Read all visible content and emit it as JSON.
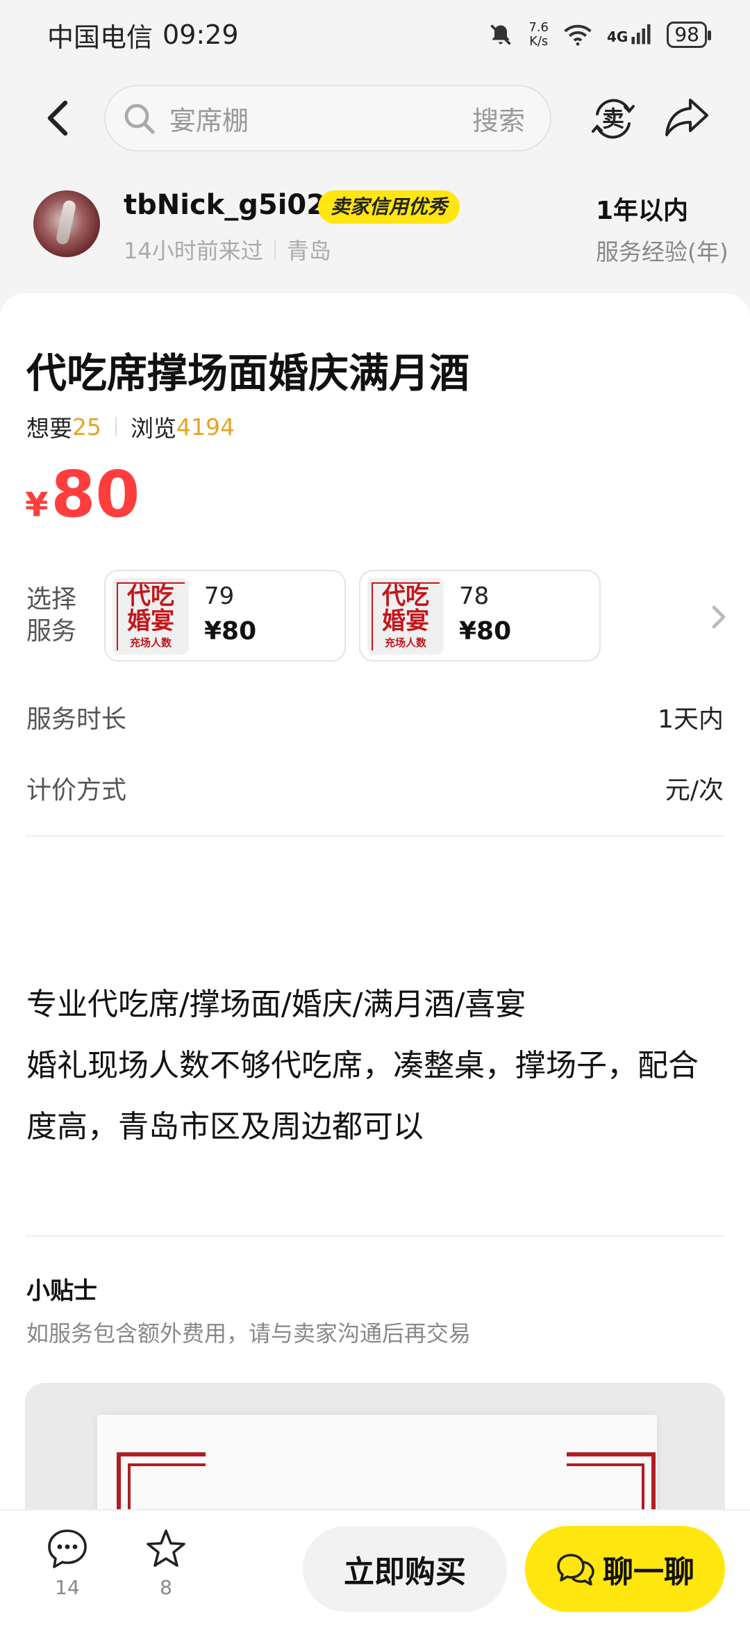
{
  "status_bar": {
    "carrier": "中国电信",
    "time": "09:29",
    "net_speed_value": "7.6",
    "net_speed_unit": "K/s",
    "network": "4G",
    "battery": "98"
  },
  "nav": {
    "search_placeholder": "宴席棚",
    "search_button": "搜索",
    "sell_icon_char": "卖"
  },
  "seller": {
    "name": "tbNick_g5i02",
    "badge": "卖家信用优秀",
    "last_seen": "14小时前来过",
    "location": "青岛",
    "experience_value": "1年以内",
    "experience_label": "服务经验(年)"
  },
  "item": {
    "title": "代吃席撑场面婚庆满月酒",
    "want_label": "想要",
    "want_count": "25",
    "view_label": "浏览",
    "view_count": "4194",
    "currency": "¥",
    "price": "80"
  },
  "service_select": {
    "label": "选择服务",
    "options": [
      {
        "name": "79",
        "price": "¥80",
        "thumb_line1": "代吃",
        "thumb_line2": "婚宴",
        "thumb_line3": "充场人数"
      },
      {
        "name": "78",
        "price": "¥80",
        "thumb_line1": "代吃",
        "thumb_line2": "婚宴",
        "thumb_line3": "充场人数"
      }
    ]
  },
  "details": {
    "duration_label": "服务时长",
    "duration_value": "1天内",
    "pricing_label": "计价方式",
    "pricing_value": "元/次"
  },
  "description": {
    "line1": "专业代吃席/撑场面/婚庆/满月酒/喜宴",
    "line2": "婚礼现场人数不够代吃席，凑整桌，撑场子，配合度高，青岛市区及周边都可以"
  },
  "tips": {
    "title": "小贴士",
    "text": "如服务包含额外费用，请与卖家沟通后再交易"
  },
  "bottom_bar": {
    "comments_count": "14",
    "favorites_count": "8",
    "buy_label": "立即购买",
    "chat_label": "聊一聊"
  },
  "colors": {
    "accent_yellow": "#ffe60f",
    "price_red": "#ff3d3d",
    "count_orange": "#e6a323"
  }
}
